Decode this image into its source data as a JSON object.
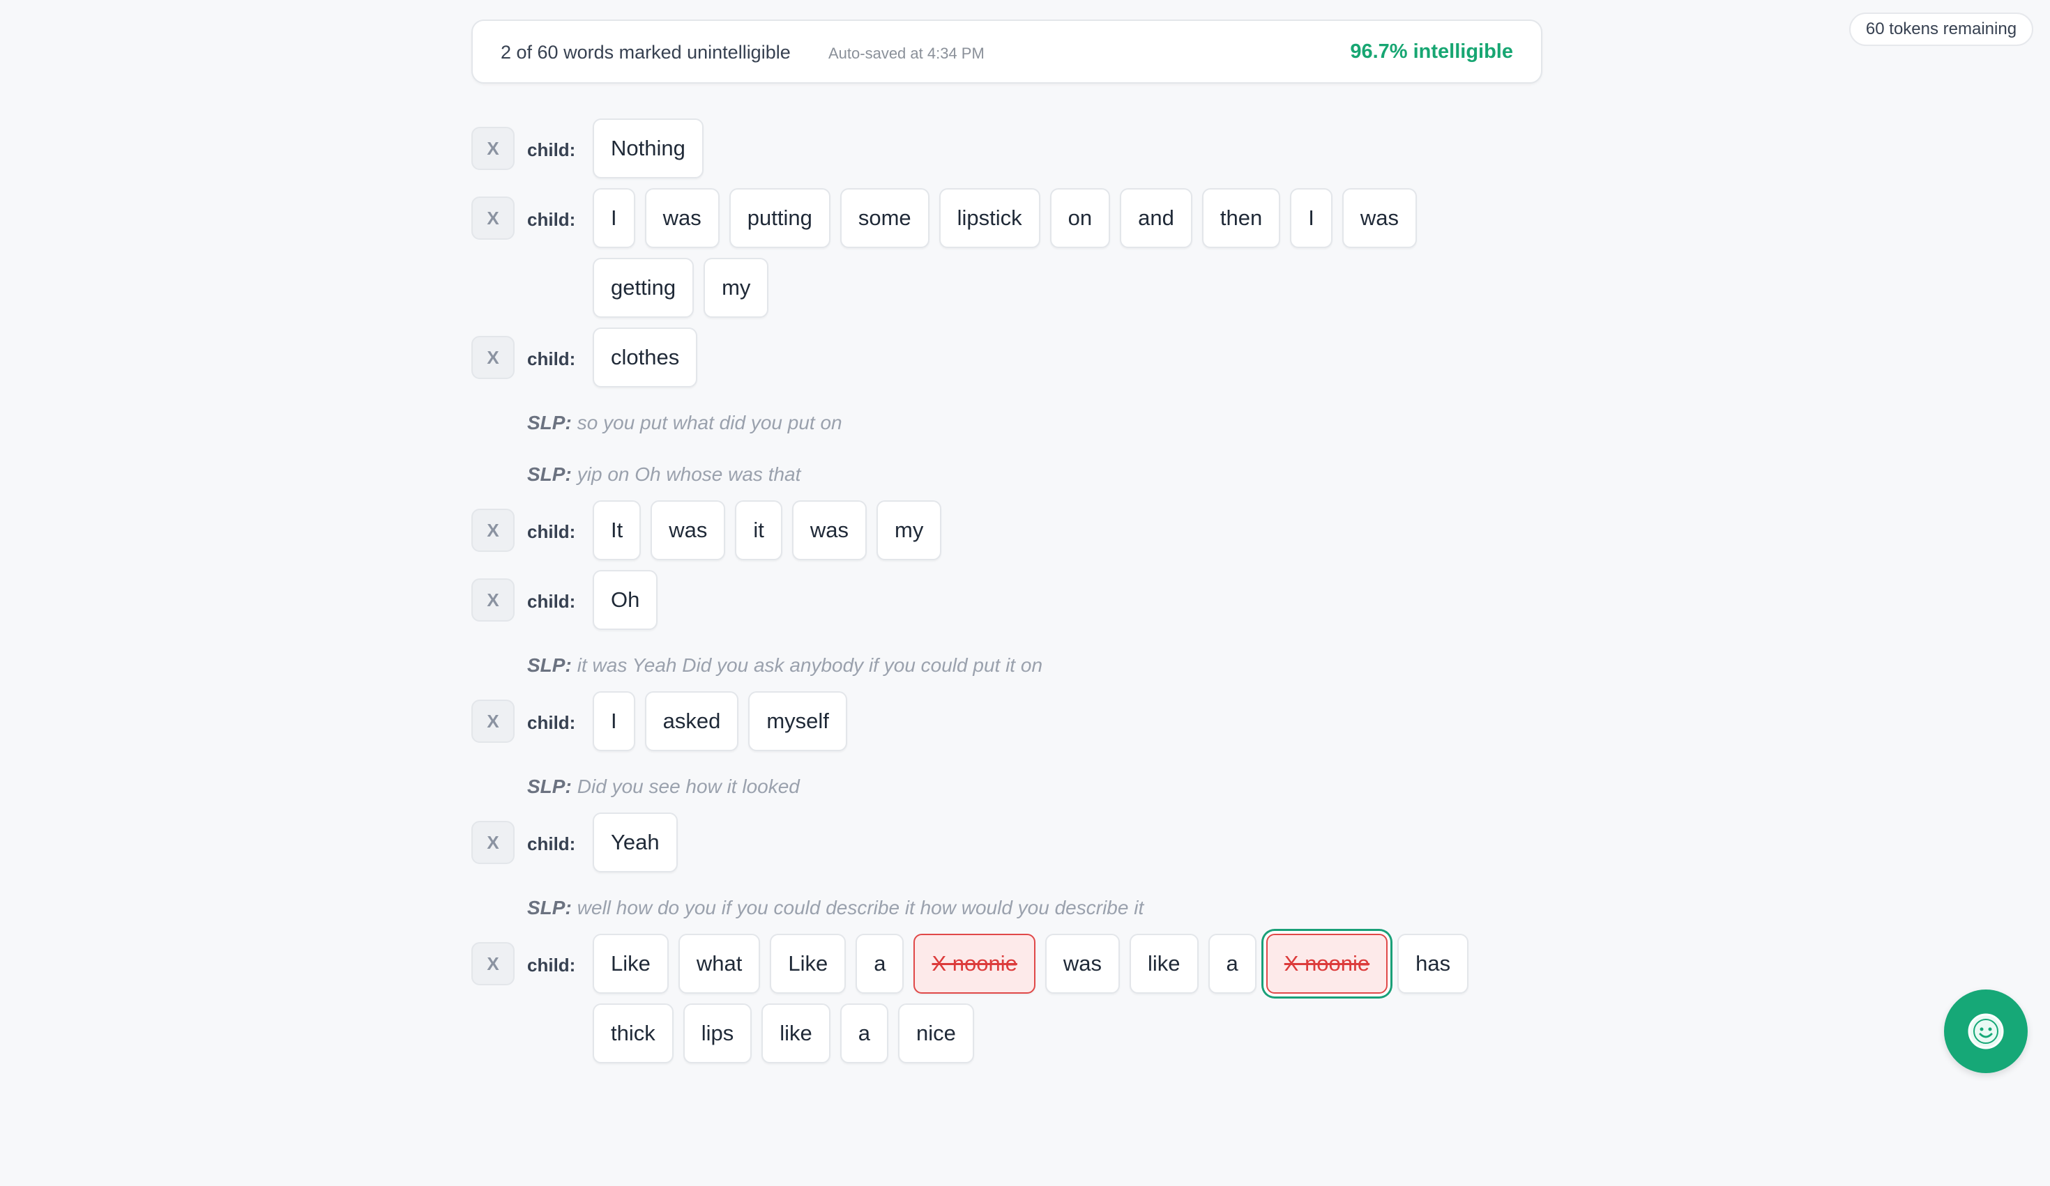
{
  "tokens_remaining": "60 tokens remaining",
  "status": {
    "marked_count": "2 of 60 words marked unintelligible",
    "autosave": "Auto-saved at 4:34 PM",
    "intelligibility": "96.7% intelligible"
  },
  "remove_label": "X",
  "speaker_child": "child:",
  "speaker_slp": "SLP:",
  "transcript": [
    {
      "type": "child",
      "words": [
        {
          "text": "Nothing"
        }
      ]
    },
    {
      "type": "child",
      "words": [
        {
          "text": "I"
        },
        {
          "text": "was"
        },
        {
          "text": "putting"
        },
        {
          "text": "some"
        },
        {
          "text": "lipstick"
        },
        {
          "text": "on"
        },
        {
          "text": "and"
        },
        {
          "text": "then"
        },
        {
          "text": "I"
        },
        {
          "text": "was"
        },
        {
          "text": "getting"
        },
        {
          "text": "my"
        }
      ]
    },
    {
      "type": "child",
      "words": [
        {
          "text": "clothes"
        }
      ]
    },
    {
      "type": "slp",
      "text": "so you put what did you put on"
    },
    {
      "type": "slp",
      "text": "yip on Oh whose was that"
    },
    {
      "type": "child",
      "words": [
        {
          "text": "It"
        },
        {
          "text": "was"
        },
        {
          "text": "it"
        },
        {
          "text": "was"
        },
        {
          "text": "my"
        }
      ]
    },
    {
      "type": "child",
      "words": [
        {
          "text": "Oh"
        }
      ]
    },
    {
      "type": "slp",
      "text": "it was Yeah Did you ask anybody if you could put it on"
    },
    {
      "type": "child",
      "words": [
        {
          "text": "I"
        },
        {
          "text": "asked"
        },
        {
          "text": "myself"
        }
      ]
    },
    {
      "type": "slp",
      "text": "Did you see how it looked"
    },
    {
      "type": "child",
      "words": [
        {
          "text": "Yeah"
        }
      ]
    },
    {
      "type": "slp",
      "text": "well how do you if you could describe it how would you describe it"
    },
    {
      "type": "child",
      "words": [
        {
          "text": "Like"
        },
        {
          "text": "what"
        },
        {
          "text": "Like"
        },
        {
          "text": "a"
        },
        {
          "text": "X noonie",
          "marked": true
        },
        {
          "text": "was"
        },
        {
          "text": "like"
        },
        {
          "text": "a"
        },
        {
          "text": "X noonie",
          "marked": true,
          "selected": true
        },
        {
          "text": "has"
        },
        {
          "text": "thick"
        },
        {
          "text": "lips"
        },
        {
          "text": "like"
        },
        {
          "text": "a"
        },
        {
          "text": "nice"
        }
      ]
    }
  ],
  "colors": {
    "accent": "#16a877",
    "marked": "#dc3b3b",
    "background": "#f7f8fa"
  },
  "help_icon": "smiley-face-icon"
}
